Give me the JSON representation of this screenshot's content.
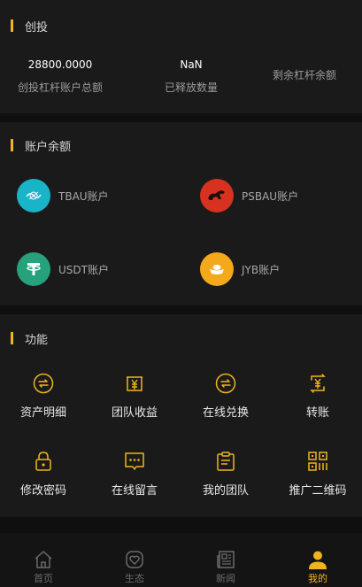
{
  "invest": {
    "title": "创投",
    "stats": [
      {
        "value": "28800.0000",
        "label": "创投杠杆账户总额"
      },
      {
        "value": "NaN",
        "label": "已释放数量"
      },
      {
        "value": "",
        "label": "剩余杠杆余额"
      }
    ]
  },
  "balance": {
    "title": "账户余额",
    "accounts": [
      {
        "name": "TBAU账户",
        "icon": "tbau-coin-icon",
        "color": "#19b4c8"
      },
      {
        "name": "PSBAU账户",
        "icon": "psbau-coin-icon",
        "color": "#d6321f"
      },
      {
        "name": "USDT账户",
        "icon": "tether-icon",
        "color": "#26a17b"
      },
      {
        "name": "JYB账户",
        "icon": "gold-ingot-icon",
        "color": "#f3a91a"
      }
    ]
  },
  "functions": {
    "title": "功能",
    "items": [
      {
        "label": "资产明细",
        "icon": "exchange-circle-icon"
      },
      {
        "label": "团队收益",
        "icon": "yen-receipt-icon"
      },
      {
        "label": "在线兑换",
        "icon": "exchange-circle-icon"
      },
      {
        "label": "转账",
        "icon": "yen-transfer-icon"
      },
      {
        "label": "修改密码",
        "icon": "lock-icon"
      },
      {
        "label": "在线留言",
        "icon": "message-icon"
      },
      {
        "label": "我的团队",
        "icon": "clipboard-icon"
      },
      {
        "label": "推广二维码",
        "icon": "qr-code-icon"
      }
    ]
  },
  "tabbar": {
    "items": [
      {
        "label": "首页",
        "icon": "home-icon"
      },
      {
        "label": "生态",
        "icon": "heart-shield-icon"
      },
      {
        "label": "新闻",
        "icon": "newspaper-icon"
      },
      {
        "label": "我的",
        "icon": "user-icon"
      }
    ],
    "active": 3
  },
  "colors": {
    "accent": "#f2b41c",
    "card": "#1a1a1a",
    "background": "#0f0f0f"
  }
}
